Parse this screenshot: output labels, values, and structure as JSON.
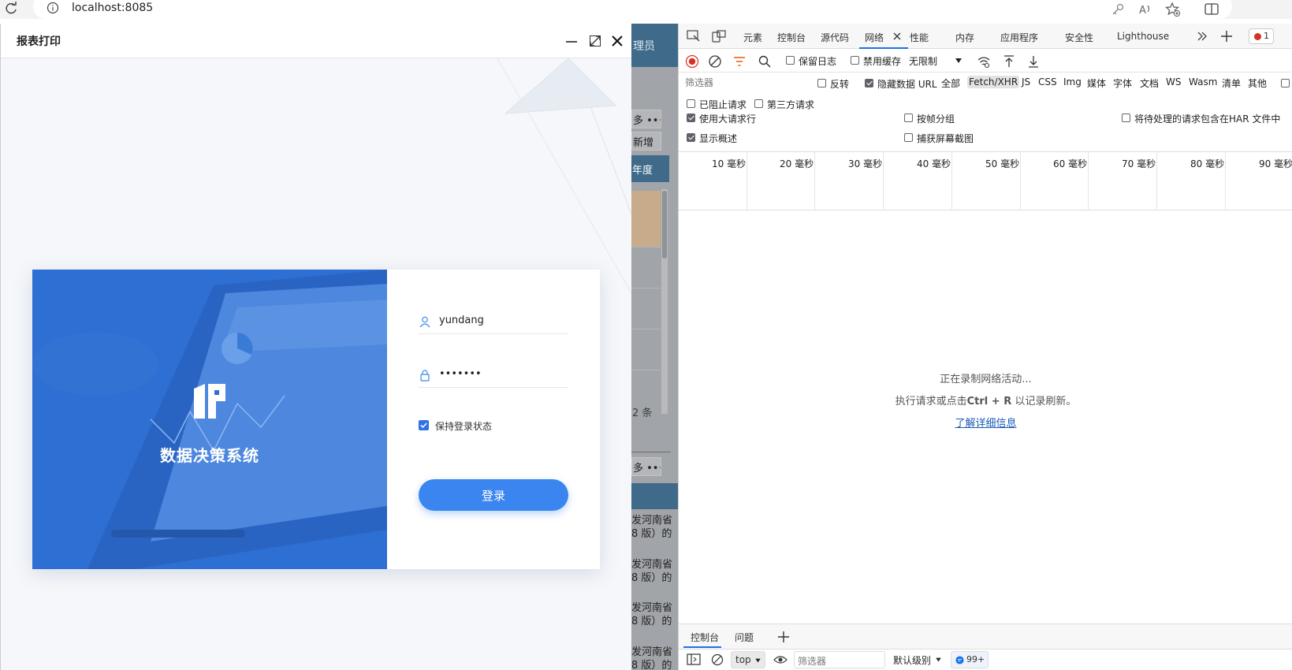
{
  "browser": {
    "url": "localhost:8085",
    "icons": [
      "reload-icon",
      "site-info-icon",
      "password-key-icon",
      "read-aloud-icon",
      "favorites-add-icon",
      "split-screen-icon"
    ]
  },
  "modal": {
    "title": "报表打印",
    "controls": [
      "minimize-icon",
      "maximize-icon",
      "close-icon"
    ],
    "hero_title": "数据决策系统",
    "username": "yundang",
    "password_mask": "•••••••",
    "remember_label": "保持登录状态",
    "remember_checked": true,
    "login_label": "登录",
    "accent_color": "#3a85f0",
    "hero_color": "#2b6fd6"
  },
  "background_app": {
    "header_fragment": "理员",
    "more_label": "多 •••",
    "add_label": "新增",
    "column_fragment": "年度",
    "count_fragment": "2 条",
    "more_label_2": "多 •••",
    "rows": [
      {
        "line1": "发河南省",
        "line2": "8 版）的"
      },
      {
        "line1": "发河南省",
        "line2": "8 版）的"
      },
      {
        "line1": "发河南省",
        "line2": "8 版）的"
      },
      {
        "line1": "发河南省",
        "line2": "8 版）的"
      }
    ]
  },
  "devtools": {
    "tabs": [
      {
        "id": "elements",
        "label": "元素"
      },
      {
        "id": "console",
        "label": "控制台"
      },
      {
        "id": "sources",
        "label": "源代码"
      },
      {
        "id": "network",
        "label": "网络",
        "active": true
      },
      {
        "id": "performance",
        "label": "性能"
      },
      {
        "id": "memory",
        "label": "内存"
      },
      {
        "id": "application",
        "label": "应用程序"
      },
      {
        "id": "security",
        "label": "安全性"
      },
      {
        "id": "lighthouse",
        "label": "Lighthouse"
      }
    ],
    "error_count": "1",
    "toolbar": {
      "preserve_log": "保留日志",
      "disable_cache": "禁用缓存",
      "throttling": "无限制"
    },
    "filter": {
      "placeholder": "筛选器",
      "invert": "反转",
      "hide_data_urls": "隐藏数据 URL",
      "types": [
        "全部",
        "Fetch/XHR",
        "JS",
        "CSS",
        "Img",
        "媒体",
        "字体",
        "文档",
        "WS",
        "Wasm",
        "清单",
        "其他"
      ],
      "active_type": "Fetch/XHR",
      "blocked_requests": "已阻止请求",
      "third_party": "第三方请求"
    },
    "options": {
      "big_rows": "使用大请求行",
      "group_by_frame": "按帧分组",
      "har_pending": "将待处理的请求包含在HAR 文件中",
      "show_overview": "显示概述",
      "capture_screenshots": "捕获屏幕截图"
    },
    "timeline_ticks": [
      "10 毫秒",
      "20 毫秒",
      "30 毫秒",
      "40 毫秒",
      "50 毫秒",
      "60 毫秒",
      "70 毫秒",
      "80 毫秒",
      "90 毫秒"
    ],
    "empty_state": {
      "line1": "正在录制网络活动...",
      "line2_pre": "执行请求或点击",
      "line2_keys": "Ctrl + R",
      "line2_post": "以记录刷新。",
      "link": "了解详细信息"
    },
    "drawer": {
      "tabs": [
        "控制台",
        "问题"
      ],
      "context": "top",
      "filter_placeholder": "筛选器",
      "level": "默认级别",
      "issues_count": "99+"
    }
  }
}
